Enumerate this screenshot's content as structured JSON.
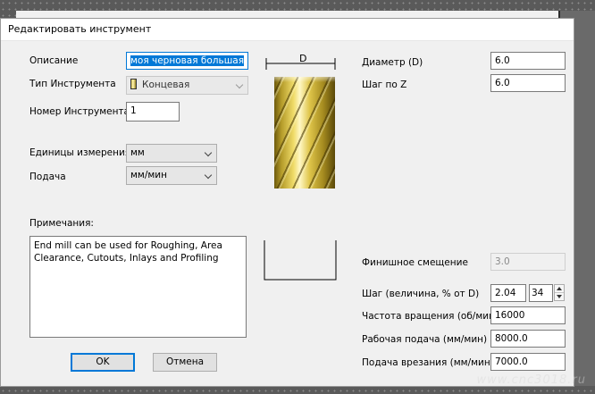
{
  "dialog": {
    "title": "Редактировать инструмент"
  },
  "form": {
    "description_label": "Описание",
    "description_value": "моя черновая большая",
    "tool_type_label": "Тип Инструмента",
    "tool_type_value": "Концевая",
    "tool_number_label": "Номер Инструмента",
    "tool_number_value": "1",
    "units_label": "Единицы измерения",
    "units_value": "мм",
    "feed_label": "Подача",
    "feed_value": "мм/мин",
    "notes_label": "Примечания:",
    "notes_value": "End mill can be used for Roughing, Area Clearance, Cutouts, Inlays and Profiling"
  },
  "diagram": {
    "d_label": "D"
  },
  "params": {
    "diameter_label": "Диаметр (D)",
    "diameter_value": "6.0",
    "stepdown_label": "Шаг по Z",
    "stepdown_value": "6.0",
    "finish_allowance_label": "Финишное смещение",
    "finish_allowance_value": "3.0",
    "stepover_label": "Шаг (величина, % от D)",
    "stepover_value": "2.04",
    "stepover_percent": "34",
    "spindle_label": "Частота вращения (об/мин)",
    "spindle_value": "16000",
    "feedrate_label": "Рабочая подача (мм/мин)",
    "feedrate_value": "8000.0",
    "plunge_label": "Подача врезания (мм/мин)",
    "plunge_value": "7000.0"
  },
  "buttons": {
    "ok": "OK",
    "cancel": "Отмена"
  },
  "watermark": "www.cnc3018.ru",
  "colors": {
    "focus_blue": "#0078d7",
    "dialog_bg": "#f0f0f0"
  }
}
